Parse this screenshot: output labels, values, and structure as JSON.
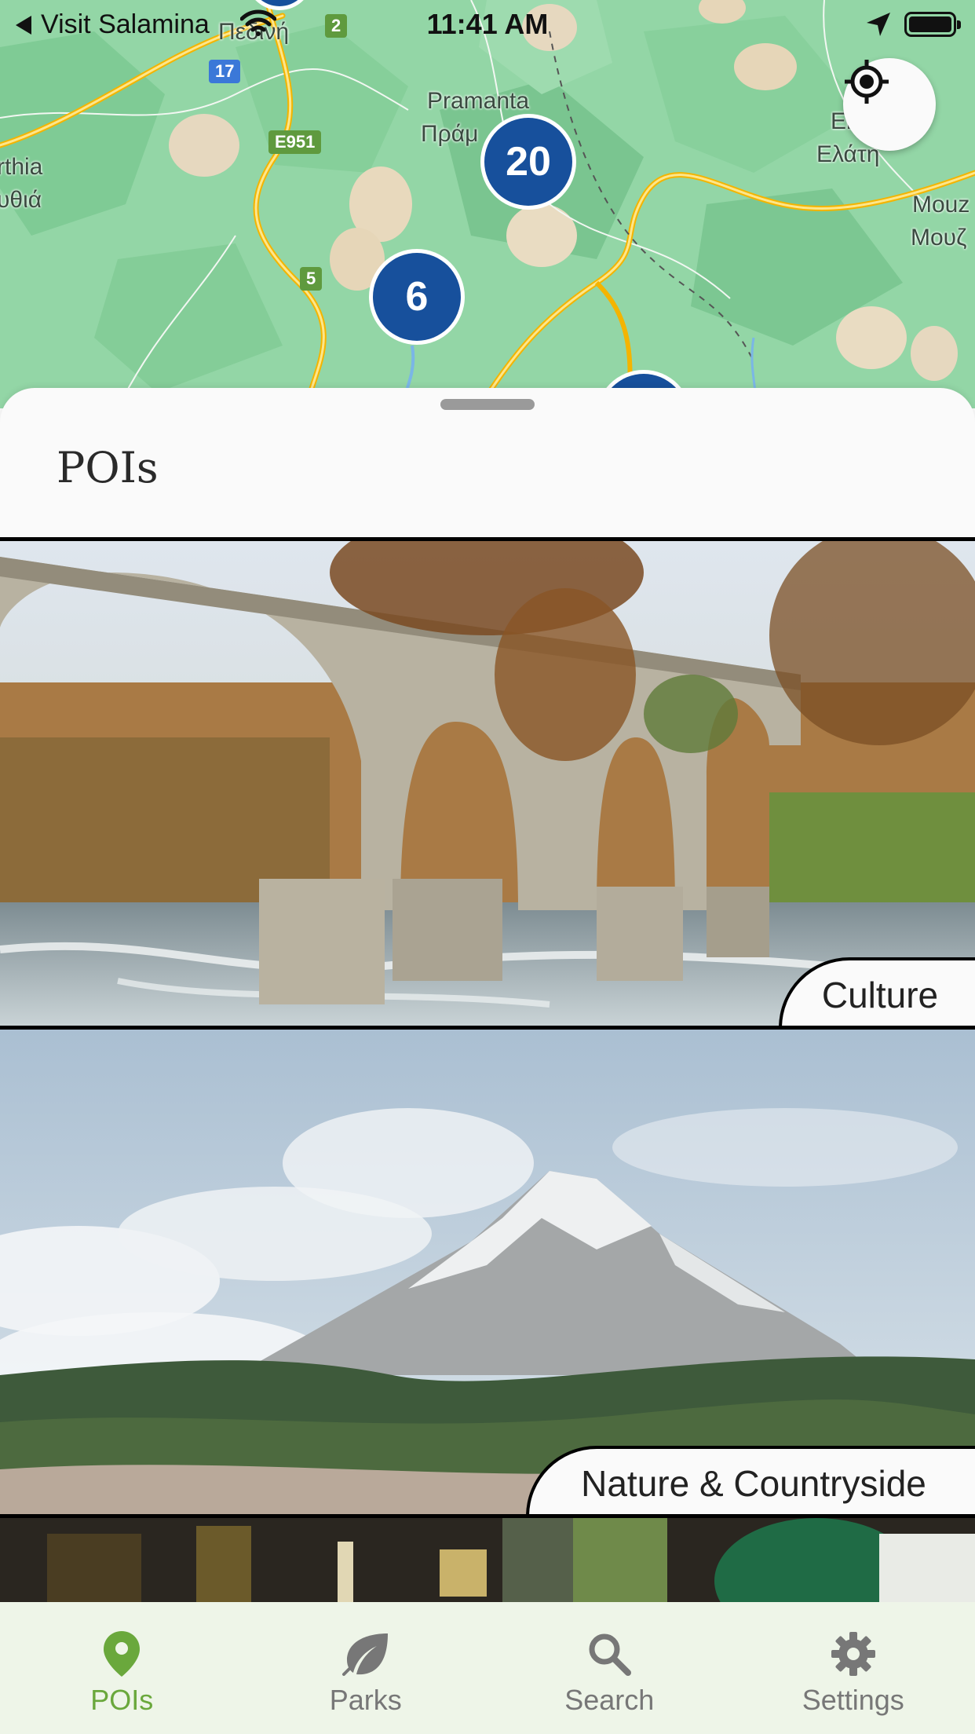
{
  "status_bar": {
    "back_label": "Visit Salamina",
    "time": "11:41 AM"
  },
  "map": {
    "labels": {
      "pediní": "Πεδινή",
      "pramanta": "Pramanta",
      "pramanta_gr": "Πράμ",
      "arthia": "rthia",
      "arthia_gr": "υθιά",
      "elati_latin": "El",
      "elati_gr": "Ελάτη",
      "mouz": "Mouz",
      "mouz_gr": "Μουζ"
    },
    "road_shields": {
      "r2": "2",
      "r17": "17",
      "e951": "E951",
      "r5": "5"
    },
    "clusters": {
      "c20": "20",
      "c6": "6"
    },
    "locate_icon": "crosshair-target-icon"
  },
  "sheet": {
    "title": "POIs"
  },
  "cards": [
    {
      "category": "Culture",
      "image": "stone-arch-bridge-photo"
    },
    {
      "category": "Nature & Countryside",
      "image": "snowy-mountain-village-photo"
    },
    {
      "category": "",
      "image": "food-market-photo"
    }
  ],
  "tabs": [
    {
      "label": "POIs",
      "icon": "map-pin-icon",
      "active": true
    },
    {
      "label": "Parks",
      "icon": "leaf-icon",
      "active": false
    },
    {
      "label": "Search",
      "icon": "search-icon",
      "active": false
    },
    {
      "label": "Settings",
      "icon": "gear-icon",
      "active": false
    }
  ],
  "colors": {
    "accent": "#6aa83c",
    "tab_inactive": "#777777",
    "cluster": "#17509c",
    "tab_bar_bg": "#eef5e8"
  }
}
